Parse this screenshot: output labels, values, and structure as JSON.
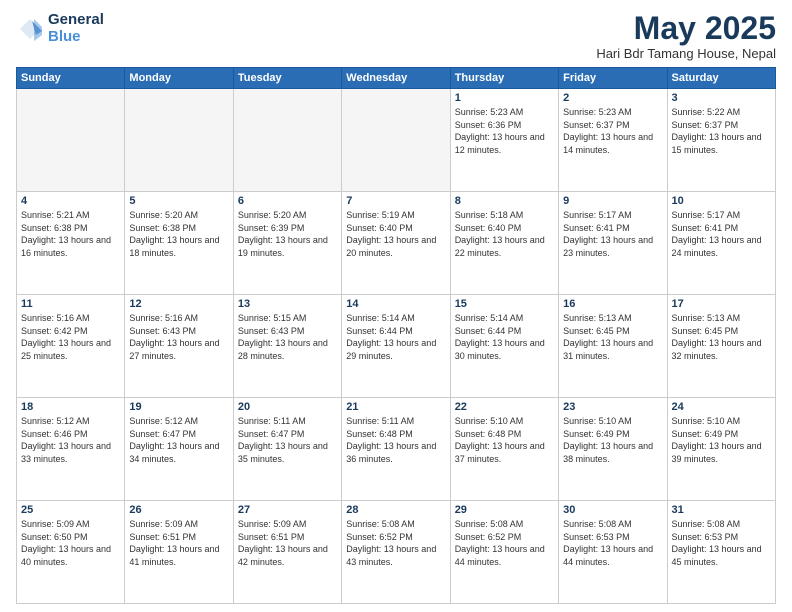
{
  "header": {
    "logo_line1": "General",
    "logo_line2": "Blue",
    "month": "May 2025",
    "location": "Hari Bdr Tamang House, Nepal"
  },
  "weekdays": [
    "Sunday",
    "Monday",
    "Tuesday",
    "Wednesday",
    "Thursday",
    "Friday",
    "Saturday"
  ],
  "weeks": [
    [
      {
        "day": "",
        "sunrise": "",
        "sunset": "",
        "daylight": "",
        "empty": true
      },
      {
        "day": "",
        "sunrise": "",
        "sunset": "",
        "daylight": "",
        "empty": true
      },
      {
        "day": "",
        "sunrise": "",
        "sunset": "",
        "daylight": "",
        "empty": true
      },
      {
        "day": "",
        "sunrise": "",
        "sunset": "",
        "daylight": "",
        "empty": true
      },
      {
        "day": "1",
        "sunrise": "Sunrise: 5:23 AM",
        "sunset": "Sunset: 6:36 PM",
        "daylight": "Daylight: 13 hours and 12 minutes.",
        "empty": false
      },
      {
        "day": "2",
        "sunrise": "Sunrise: 5:23 AM",
        "sunset": "Sunset: 6:37 PM",
        "daylight": "Daylight: 13 hours and 14 minutes.",
        "empty": false
      },
      {
        "day": "3",
        "sunrise": "Sunrise: 5:22 AM",
        "sunset": "Sunset: 6:37 PM",
        "daylight": "Daylight: 13 hours and 15 minutes.",
        "empty": false
      }
    ],
    [
      {
        "day": "4",
        "sunrise": "Sunrise: 5:21 AM",
        "sunset": "Sunset: 6:38 PM",
        "daylight": "Daylight: 13 hours and 16 minutes.",
        "empty": false
      },
      {
        "day": "5",
        "sunrise": "Sunrise: 5:20 AM",
        "sunset": "Sunset: 6:38 PM",
        "daylight": "Daylight: 13 hours and 18 minutes.",
        "empty": false
      },
      {
        "day": "6",
        "sunrise": "Sunrise: 5:20 AM",
        "sunset": "Sunset: 6:39 PM",
        "daylight": "Daylight: 13 hours and 19 minutes.",
        "empty": false
      },
      {
        "day": "7",
        "sunrise": "Sunrise: 5:19 AM",
        "sunset": "Sunset: 6:40 PM",
        "daylight": "Daylight: 13 hours and 20 minutes.",
        "empty": false
      },
      {
        "day": "8",
        "sunrise": "Sunrise: 5:18 AM",
        "sunset": "Sunset: 6:40 PM",
        "daylight": "Daylight: 13 hours and 22 minutes.",
        "empty": false
      },
      {
        "day": "9",
        "sunrise": "Sunrise: 5:17 AM",
        "sunset": "Sunset: 6:41 PM",
        "daylight": "Daylight: 13 hours and 23 minutes.",
        "empty": false
      },
      {
        "day": "10",
        "sunrise": "Sunrise: 5:17 AM",
        "sunset": "Sunset: 6:41 PM",
        "daylight": "Daylight: 13 hours and 24 minutes.",
        "empty": false
      }
    ],
    [
      {
        "day": "11",
        "sunrise": "Sunrise: 5:16 AM",
        "sunset": "Sunset: 6:42 PM",
        "daylight": "Daylight: 13 hours and 25 minutes.",
        "empty": false
      },
      {
        "day": "12",
        "sunrise": "Sunrise: 5:16 AM",
        "sunset": "Sunset: 6:43 PM",
        "daylight": "Daylight: 13 hours and 27 minutes.",
        "empty": false
      },
      {
        "day": "13",
        "sunrise": "Sunrise: 5:15 AM",
        "sunset": "Sunset: 6:43 PM",
        "daylight": "Daylight: 13 hours and 28 minutes.",
        "empty": false
      },
      {
        "day": "14",
        "sunrise": "Sunrise: 5:14 AM",
        "sunset": "Sunset: 6:44 PM",
        "daylight": "Daylight: 13 hours and 29 minutes.",
        "empty": false
      },
      {
        "day": "15",
        "sunrise": "Sunrise: 5:14 AM",
        "sunset": "Sunset: 6:44 PM",
        "daylight": "Daylight: 13 hours and 30 minutes.",
        "empty": false
      },
      {
        "day": "16",
        "sunrise": "Sunrise: 5:13 AM",
        "sunset": "Sunset: 6:45 PM",
        "daylight": "Daylight: 13 hours and 31 minutes.",
        "empty": false
      },
      {
        "day": "17",
        "sunrise": "Sunrise: 5:13 AM",
        "sunset": "Sunset: 6:45 PM",
        "daylight": "Daylight: 13 hours and 32 minutes.",
        "empty": false
      }
    ],
    [
      {
        "day": "18",
        "sunrise": "Sunrise: 5:12 AM",
        "sunset": "Sunset: 6:46 PM",
        "daylight": "Daylight: 13 hours and 33 minutes.",
        "empty": false
      },
      {
        "day": "19",
        "sunrise": "Sunrise: 5:12 AM",
        "sunset": "Sunset: 6:47 PM",
        "daylight": "Daylight: 13 hours and 34 minutes.",
        "empty": false
      },
      {
        "day": "20",
        "sunrise": "Sunrise: 5:11 AM",
        "sunset": "Sunset: 6:47 PM",
        "daylight": "Daylight: 13 hours and 35 minutes.",
        "empty": false
      },
      {
        "day": "21",
        "sunrise": "Sunrise: 5:11 AM",
        "sunset": "Sunset: 6:48 PM",
        "daylight": "Daylight: 13 hours and 36 minutes.",
        "empty": false
      },
      {
        "day": "22",
        "sunrise": "Sunrise: 5:10 AM",
        "sunset": "Sunset: 6:48 PM",
        "daylight": "Daylight: 13 hours and 37 minutes.",
        "empty": false
      },
      {
        "day": "23",
        "sunrise": "Sunrise: 5:10 AM",
        "sunset": "Sunset: 6:49 PM",
        "daylight": "Daylight: 13 hours and 38 minutes.",
        "empty": false
      },
      {
        "day": "24",
        "sunrise": "Sunrise: 5:10 AM",
        "sunset": "Sunset: 6:49 PM",
        "daylight": "Daylight: 13 hours and 39 minutes.",
        "empty": false
      }
    ],
    [
      {
        "day": "25",
        "sunrise": "Sunrise: 5:09 AM",
        "sunset": "Sunset: 6:50 PM",
        "daylight": "Daylight: 13 hours and 40 minutes.",
        "empty": false
      },
      {
        "day": "26",
        "sunrise": "Sunrise: 5:09 AM",
        "sunset": "Sunset: 6:51 PM",
        "daylight": "Daylight: 13 hours and 41 minutes.",
        "empty": false
      },
      {
        "day": "27",
        "sunrise": "Sunrise: 5:09 AM",
        "sunset": "Sunset: 6:51 PM",
        "daylight": "Daylight: 13 hours and 42 minutes.",
        "empty": false
      },
      {
        "day": "28",
        "sunrise": "Sunrise: 5:08 AM",
        "sunset": "Sunset: 6:52 PM",
        "daylight": "Daylight: 13 hours and 43 minutes.",
        "empty": false
      },
      {
        "day": "29",
        "sunrise": "Sunrise: 5:08 AM",
        "sunset": "Sunset: 6:52 PM",
        "daylight": "Daylight: 13 hours and 44 minutes.",
        "empty": false
      },
      {
        "day": "30",
        "sunrise": "Sunrise: 5:08 AM",
        "sunset": "Sunset: 6:53 PM",
        "daylight": "Daylight: 13 hours and 44 minutes.",
        "empty": false
      },
      {
        "day": "31",
        "sunrise": "Sunrise: 5:08 AM",
        "sunset": "Sunset: 6:53 PM",
        "daylight": "Daylight: 13 hours and 45 minutes.",
        "empty": false
      }
    ]
  ]
}
